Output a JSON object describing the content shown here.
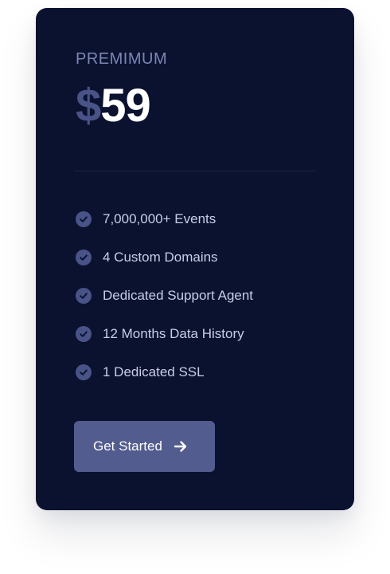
{
  "plan": {
    "name": "PREMIMUM",
    "currency_symbol": "$",
    "price": "59"
  },
  "features": [
    {
      "label": "7,000,000+ Events",
      "icon": "check-circle-icon"
    },
    {
      "label": "4 Custom Domains",
      "icon": "check-circle-icon"
    },
    {
      "label": "Dedicated Support Agent",
      "icon": "check-circle-icon"
    },
    {
      "label": "12 Months Data History",
      "icon": "check-circle-icon"
    },
    {
      "label": "1 Dedicated SSL",
      "icon": "check-circle-icon"
    }
  ],
  "cta": {
    "label": "Get Started",
    "icon": "arrow-right-icon"
  },
  "colors": {
    "card_background": "#0a1230",
    "accent": "#525c8e",
    "check_circle": "#4a5387",
    "muted_text": "#7d86b3",
    "feature_text": "#c9cde6"
  }
}
